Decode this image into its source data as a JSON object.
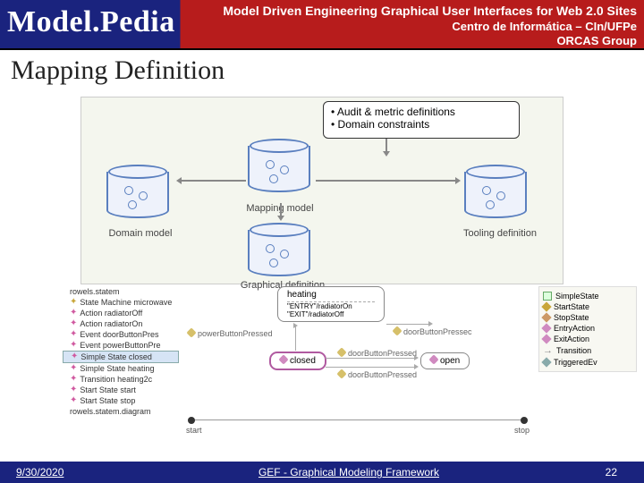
{
  "header": {
    "brand": "Model.Pedia",
    "title": "Model Driven Engineering Graphical User Interfaces for Web 2.0 Sites",
    "sub1": "Centro de Informática – CIn/UFPe",
    "sub2": "ORCAS Group"
  },
  "slide": {
    "title": "Mapping Definition"
  },
  "diagram": {
    "note1": "Audit & metric definitions",
    "note2": "Domain constraints",
    "cyl_domain": "Domain model",
    "cyl_mapping": "Mapping model",
    "cyl_graphical": "Graphical definition",
    "cyl_tooling": "Tooling definition"
  },
  "tree": {
    "h": "rowels.statem",
    "items": [
      "State Machine microwave",
      "Action radiatorOff",
      "Action radiatorOn",
      "Event doorButtonPres",
      "Event powerButtonPre",
      "Simple State closed",
      "Simple State heating",
      "Transition heating2c",
      "Start State start",
      "Start State stop"
    ],
    "tail": "rowels.statem.diagram",
    "sel_index": 5
  },
  "graph": {
    "heating": "heating",
    "heating_l1": "\"ENTRY\"/radiatorOn",
    "heating_l2": "\"EXIT\"/radiatorOff",
    "closed": "closed",
    "open": "open",
    "powerBtn": "powerButtonPressed",
    "doorBtn": "doorButtonPressed",
    "doorBtn2": "doorButtonPressec",
    "start": "start",
    "stop": "stop"
  },
  "legend": {
    "items": [
      {
        "icon": "green",
        "label": "SimpleState"
      },
      {
        "icon": "y",
        "label": "StartState"
      },
      {
        "icon": "r",
        "label": "StopState"
      },
      {
        "icon": "p",
        "label": "EntryAction"
      },
      {
        "icon": "p",
        "label": "ExitAction"
      },
      {
        "icon": "arr",
        "label": "Transition"
      },
      {
        "icon": "g",
        "label": "TriggeredEv"
      }
    ]
  },
  "footer": {
    "date": "9/30/2020",
    "mid": "GEF - Graphical Modeling Framework",
    "num": "22"
  }
}
